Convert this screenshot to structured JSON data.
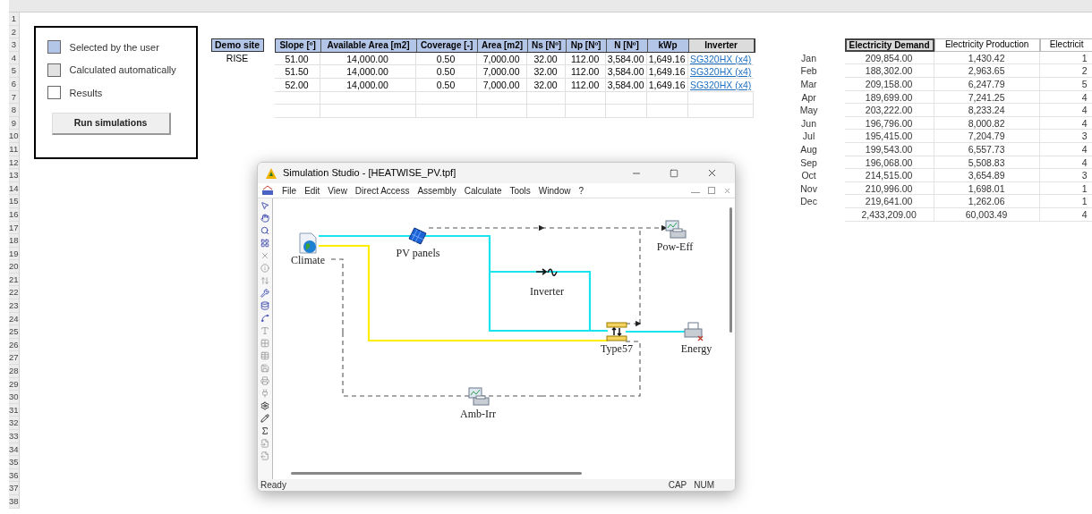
{
  "row_numbers": [
    "1",
    "2",
    "3",
    "4",
    "5",
    "6",
    "7",
    "8",
    "9",
    "10",
    "11",
    "12",
    "13",
    "14",
    "15",
    "16",
    "17",
    "18",
    "19",
    "20",
    "21",
    "22",
    "23",
    "24",
    "25",
    "26",
    "27",
    "28",
    "29",
    "30",
    "31",
    "32",
    "33",
    "34",
    "35",
    "36",
    "37",
    "38"
  ],
  "legend": {
    "items": [
      {
        "label": "Selected by the user",
        "color": "#b4c6e7"
      },
      {
        "label": "Calculated automatically",
        "color": "#e2e2e2"
      },
      {
        "label": "Results",
        "color": "#ffffff"
      }
    ],
    "button": "Run simulations"
  },
  "demo_site": {
    "header": "Demo site",
    "value": "RISE"
  },
  "pv_table": {
    "columns": [
      {
        "label": "Slope [º]",
        "kind": "input"
      },
      {
        "label": "Available Area [m2]",
        "kind": "input"
      },
      {
        "label": "Coverage [-]",
        "kind": "input"
      },
      {
        "label": "Area [m2]",
        "kind": "input"
      },
      {
        "label": "Ns [Nº]",
        "kind": "input"
      },
      {
        "label": "Np [Nº]",
        "kind": "input"
      },
      {
        "label": "N [Nº]",
        "kind": "input"
      },
      {
        "label": "kWp",
        "kind": "input"
      },
      {
        "label": "Inverter",
        "kind": "calculated"
      }
    ],
    "rows": [
      [
        "51.00",
        "14,000.00",
        "0.50",
        "7,000.00",
        "32.00",
        "112.00",
        "3,584.00",
        "1,649.16",
        "SG320HX (x4)"
      ],
      [
        "51.50",
        "14,000.00",
        "0.50",
        "7,000.00",
        "32.00",
        "112.00",
        "3,584.00",
        "1,649.16",
        "SG320HX (x4)"
      ],
      [
        "52.00",
        "14,000.00",
        "0.50",
        "7,000.00",
        "32.00",
        "112.00",
        "3,584.00",
        "1,649.16",
        "SG320HX (x4)"
      ]
    ]
  },
  "monthly_table": {
    "columns": [
      {
        "label": "Electricity Demand",
        "kind": "calculated"
      },
      {
        "label": "Electricity Production",
        "kind": "result"
      },
      {
        "label": "Electricit",
        "kind": "result"
      }
    ],
    "rows": [
      {
        "month": "Jan",
        "values": [
          "209,854.00",
          "1,430.42",
          "1"
        ]
      },
      {
        "month": "Feb",
        "values": [
          "188,302.00",
          "2,963.65",
          "2"
        ]
      },
      {
        "month": "Mar",
        "values": [
          "209,158.00",
          "6,247.79",
          "5"
        ]
      },
      {
        "month": "Apr",
        "values": [
          "189,699.00",
          "7,241.25",
          "4"
        ]
      },
      {
        "month": "May",
        "values": [
          "203,222.00",
          "8,233.24",
          "4"
        ]
      },
      {
        "month": "Jun",
        "values": [
          "196,796.00",
          "8,000.82",
          "4"
        ]
      },
      {
        "month": "Jul",
        "values": [
          "195,415.00",
          "7,204.79",
          "3"
        ]
      },
      {
        "month": "Aug",
        "values": [
          "199,543.00",
          "6,557.73",
          "4"
        ]
      },
      {
        "month": "Sep",
        "values": [
          "196,068.00",
          "5,508.83",
          "4"
        ]
      },
      {
        "month": "Oct",
        "values": [
          "214,515.00",
          "3,654.89",
          "3"
        ]
      },
      {
        "month": "Nov",
        "values": [
          "210,996.00",
          "1,698.01",
          "1"
        ]
      },
      {
        "month": "Dec",
        "values": [
          "219,641.00",
          "1,262.06",
          "1"
        ]
      }
    ],
    "total": [
      "2,433,209.00",
      "60,003.49",
      "4"
    ]
  },
  "window": {
    "title": "Simulation Studio - [HEATWISE_PV.tpf]",
    "menu": [
      "File",
      "Edit",
      "View",
      "Direct Access",
      "Assembly",
      "Calculate",
      "Tools",
      "Window",
      "?"
    ],
    "components": [
      {
        "label": "Climate",
        "kind": "weather"
      },
      {
        "label": "PV panels",
        "kind": "panel"
      },
      {
        "label": "Pow-Eff",
        "kind": "plotter"
      },
      {
        "label": "Inverter",
        "kind": "inverter"
      },
      {
        "label": "Type57",
        "kind": "converter"
      },
      {
        "label": "Energy",
        "kind": "printer"
      },
      {
        "label": "Amb-Irr",
        "kind": "plotter"
      }
    ],
    "status": {
      "text": "Ready",
      "indicators": [
        "CAP",
        "NUM"
      ]
    }
  }
}
